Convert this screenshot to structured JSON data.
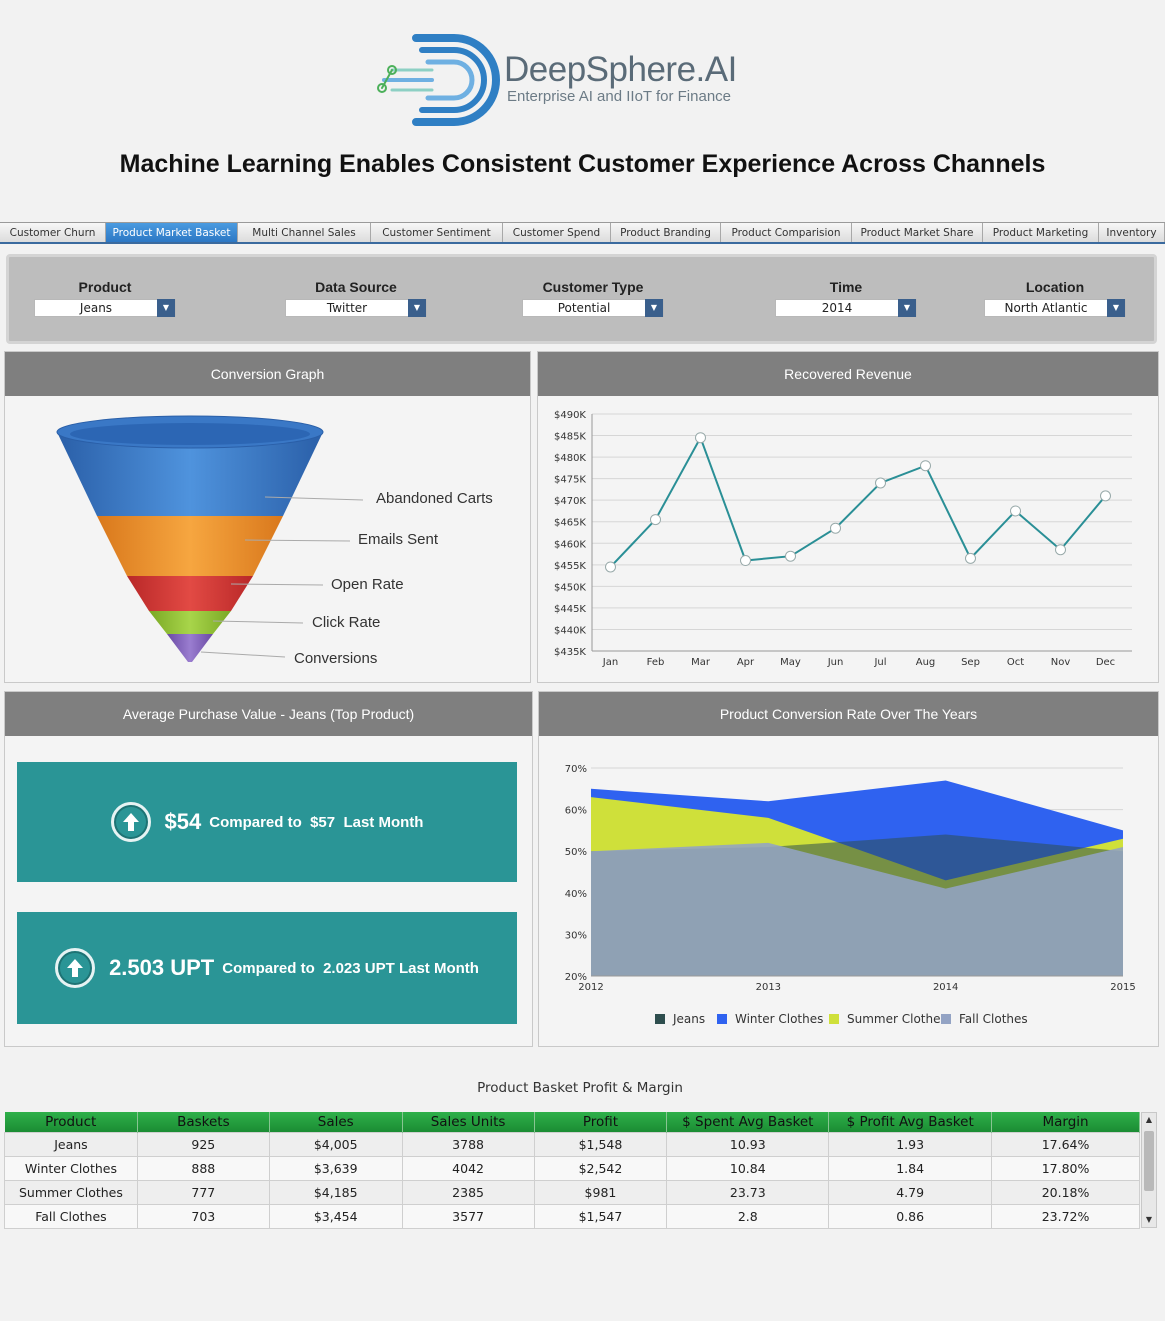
{
  "brand": {
    "name": "DeepSphere.AI",
    "tagline": "Enterprise AI and IIoT for Finance"
  },
  "page_title": "Machine Learning Enables Consistent Customer Experience Across Channels",
  "tabs": [
    {
      "label": "Customer Churn"
    },
    {
      "label": "Product Market Basket",
      "active": true
    },
    {
      "label": "Multi Channel Sales"
    },
    {
      "label": "Customer Sentiment"
    },
    {
      "label": "Customer Spend"
    },
    {
      "label": "Product Branding"
    },
    {
      "label": "Product Comparision"
    },
    {
      "label": "Product Market Share"
    },
    {
      "label": "Product Marketing"
    },
    {
      "label": "Inventory"
    }
  ],
  "filters": [
    {
      "label": "Product",
      "value": "Jeans"
    },
    {
      "label": "Data Source",
      "value": "Twitter"
    },
    {
      "label": "Customer Type",
      "value": "Potential"
    },
    {
      "label": "Time",
      "value": "2014"
    },
    {
      "label": "Location",
      "value": "North Atlantic"
    }
  ],
  "panels": {
    "conversion": "Conversion Graph",
    "revenue": "Recovered Revenue",
    "avg_purchase": "Average Purchase Value - Jeans (Top Product)",
    "conversion_rate": "Product Conversion Rate Over The Years"
  },
  "funnel_labels": [
    "Abandoned Carts",
    "Emails Sent",
    "Open Rate",
    "Click Rate",
    "Conversions"
  ],
  "kpis": {
    "value": {
      "big": "$54",
      "text": "Compared to  $57  Last Month"
    },
    "upt": {
      "big": "2.503 UPT",
      "text": "Compared to  2.023 UPT Last Month"
    }
  },
  "chart_data": [
    {
      "type": "line",
      "title": "Recovered Revenue",
      "x": [
        "Jan",
        "Feb",
        "Mar",
        "Apr",
        "May",
        "Jun",
        "Jul",
        "Aug",
        "Sep",
        "Oct",
        "Nov",
        "Dec"
      ],
      "values": [
        454.5,
        465.5,
        484.5,
        456,
        457,
        463.5,
        474,
        478,
        456.5,
        467.5,
        458.5,
        471
      ],
      "y_ticks": [
        "$435K",
        "$440K",
        "$445K",
        "$450K",
        "$455K",
        "$460K",
        "$465K",
        "$470K",
        "$475K",
        "$480K",
        "$485K",
        "$490K"
      ],
      "ylim": [
        435,
        490
      ],
      "color": "#2a8f96",
      "grid": true
    },
    {
      "type": "area",
      "title": "Product Conversion Rate Over The Years",
      "x": [
        "2012",
        "2013",
        "2014",
        "2015"
      ],
      "series": [
        {
          "name": "Jeans",
          "values": [
            50,
            51,
            54,
            50
          ],
          "color": "#2e4e4e"
        },
        {
          "name": "Winter Clothes",
          "values": [
            65,
            62,
            67,
            55
          ],
          "color": "#2f62f0"
        },
        {
          "name": "Summer Clothes",
          "values": [
            63,
            58,
            43,
            53
          ],
          "color": "#cfe03a"
        },
        {
          "name": "Fall Clothes",
          "values": [
            50,
            52,
            41,
            51
          ],
          "color": "#93a3c4"
        }
      ],
      "y_ticks": [
        "20%",
        "30%",
        "40%",
        "50%",
        "60%",
        "70%"
      ],
      "ylim": [
        20,
        70
      ],
      "legend": "bottom"
    }
  ],
  "table": {
    "title": "Product Basket Profit & Margin",
    "headers": [
      "Product",
      "Baskets",
      "Sales",
      "Sales Units",
      "Profit",
      "$ Spent Avg Basket",
      "$ Profit Avg Basket",
      "Margin"
    ],
    "rows": [
      [
        "Jeans",
        "925",
        "$4,005",
        "3788",
        "$1,548",
        "10.93",
        "1.93",
        "17.64%"
      ],
      [
        "Winter Clothes",
        "888",
        "$3,639",
        "4042",
        "$2,542",
        "10.84",
        "1.84",
        "17.80%"
      ],
      [
        "Summer Clothes",
        "777",
        "$4,185",
        "2385",
        "$981",
        "23.73",
        "4.79",
        "20.18%"
      ],
      [
        "Fall Clothes",
        "703",
        "$3,454",
        "3577",
        "$1,547",
        "2.8",
        "0.86",
        "23.72%"
      ]
    ]
  }
}
